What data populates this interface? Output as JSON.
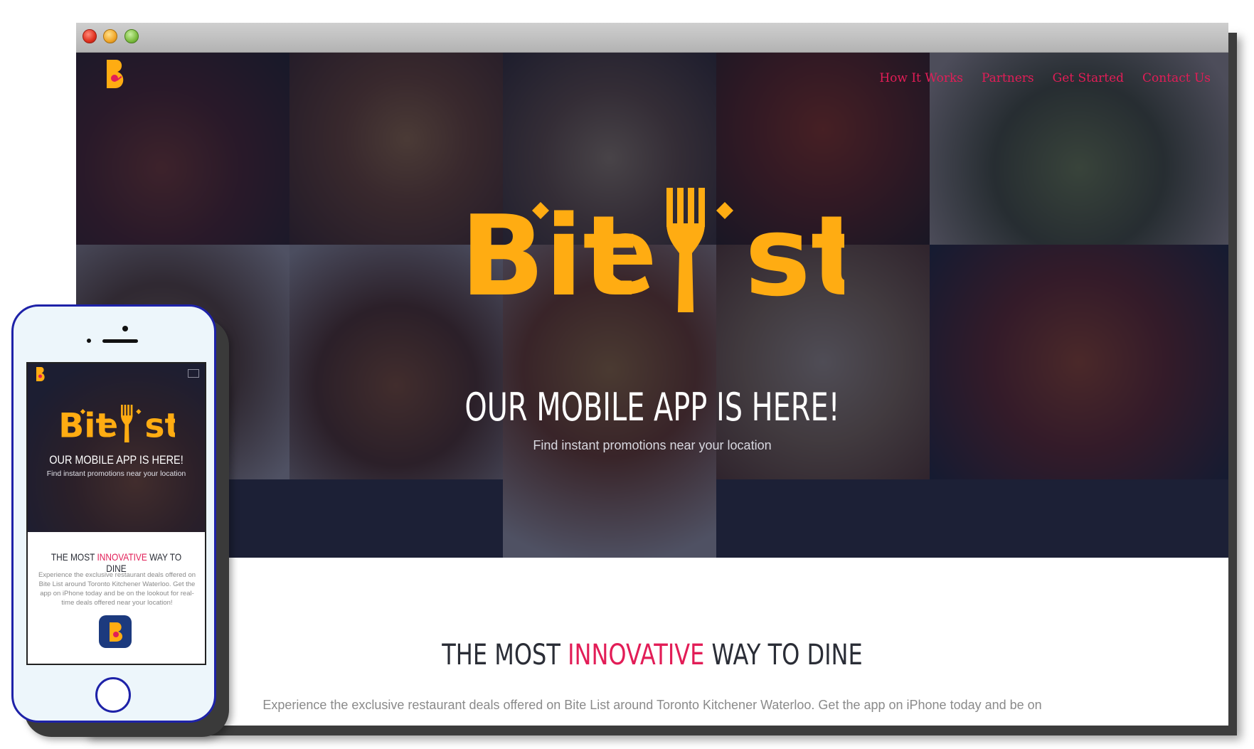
{
  "desktop": {
    "nav": [
      "How It Works",
      "Partners",
      "Get Started",
      "Contact Us"
    ],
    "brand": "BiteList",
    "hero_title": "OUR MOBILE APP IS HERE!",
    "hero_subtitle": "Find instant promotions near your location",
    "section_title_pre": "THE MOST ",
    "section_title_accent": "INNOVATIVE",
    "section_title_post": " WAY TO DINE",
    "section_text": "Experience the exclusive restaurant deals offered on Bite List around Toronto Kitchener Waterloo. Get the app on iPhone today and be on"
  },
  "phone": {
    "hero_title": "OUR MOBILE APP IS HERE!",
    "hero_subtitle": "Find instant promotions near your location",
    "section_title_pre": "THE MOST ",
    "section_title_accent": "INNOVATIVE",
    "section_title_post": " WAY TO DINE",
    "section_text": "Experience the exclusive restaurant deals offered on Bite List around Toronto Kitchener Waterloo. Get the app on iPhone today and be on the lookout for real-time deals offered near your location!"
  },
  "colors": {
    "brand_yellow": "#ffac12",
    "accent_pink": "#e21d57",
    "hero_overlay": "#10142c"
  }
}
